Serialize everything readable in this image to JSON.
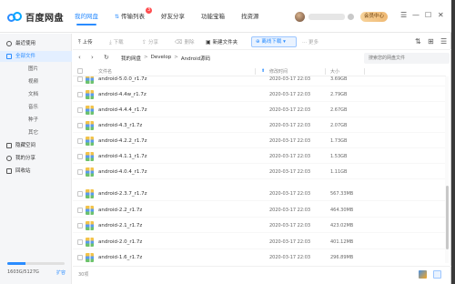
{
  "app": {
    "name": "百度网盘",
    "nav": [
      {
        "label": "我的网盘",
        "active": true
      },
      {
        "label": "传输列表",
        "badge": "3"
      },
      {
        "label": "好友分享"
      },
      {
        "label": "功能宝箱"
      },
      {
        "label": "找资源"
      }
    ],
    "vip_label": "会员中心",
    "window_controls": [
      "☰",
      "—",
      "☐",
      "✕"
    ]
  },
  "sidebar": {
    "items": [
      {
        "label": "最近使用",
        "icon": "clock-icon"
      },
      {
        "label": "全部文件",
        "icon": "folder-icon",
        "active": true
      },
      {
        "label": "图片",
        "sub": true
      },
      {
        "label": "视频",
        "sub": true
      },
      {
        "label": "文档",
        "sub": true
      },
      {
        "label": "音乐",
        "sub": true
      },
      {
        "label": "种子",
        "sub": true
      },
      {
        "label": "其它",
        "sub": true
      },
      {
        "label": "隐藏空间",
        "icon": "lock-icon"
      },
      {
        "label": "我的分享",
        "icon": "share-icon"
      },
      {
        "label": "回收站",
        "icon": "trash-icon"
      }
    ],
    "quota": {
      "text": "1603G/5127G",
      "used_fraction": 0.313,
      "link": "扩容"
    }
  },
  "toolbar": {
    "upload": "上传",
    "download": "下载",
    "share": "分享",
    "delete": "删除",
    "new_folder": "新建文件夹",
    "offline": "离线下载",
    "more": "更多"
  },
  "path": {
    "crumbs": [
      "我的网盘",
      "Develop",
      "Android源码"
    ],
    "search_placeholder": "搜索您的网盘文件"
  },
  "table": {
    "headers": {
      "name": "文件名",
      "date": "修改时间",
      "size": "大小"
    },
    "rows": [
      {
        "name": "android-5.0.0_r1.7z",
        "date": "2020-03-17 22:03",
        "size": "3.69GB"
      },
      {
        "name": "android-4.4w_r1.7z",
        "date": "2020-03-17 22:03",
        "size": "2.79GB"
      },
      {
        "name": "android-4.4.4_r1.7z",
        "date": "2020-03-17 22:03",
        "size": "2.67GB"
      },
      {
        "name": "android-4.3_r1.7z",
        "date": "2020-03-17 22:03",
        "size": "2.07GB"
      },
      {
        "name": "android-4.2.2_r1.7z",
        "date": "2020-03-17 22:03",
        "size": "1.73GB"
      },
      {
        "name": "android-4.1.1_r1.7z",
        "date": "2020-03-17 22:03",
        "size": "1.53GB"
      },
      {
        "name": "android-4.0.4_r1.7z",
        "date": "2020-03-17 22:03",
        "size": "1.11GB"
      },
      {
        "name": "android-2.3.7_r1.7z",
        "date": "2020-03-17 22:03",
        "size": "567.33MB"
      },
      {
        "name": "android-2.2_r1.7z",
        "date": "2020-03-17 22:03",
        "size": "464.30MB"
      },
      {
        "name": "android-2.1_r1.7z",
        "date": "2020-03-17 22:03",
        "size": "423.02MB"
      },
      {
        "name": "android-2.0_r1.7z",
        "date": "2020-03-17 22:03",
        "size": "401.12MB"
      },
      {
        "name": "android-1.6_r1.7z",
        "date": "2020-03-17 22:03",
        "size": "296.89MB"
      }
    ]
  },
  "footer": {
    "count": "30项"
  },
  "colors": {
    "accent": "#2a8cff",
    "vip": "#efb974",
    "active_bg": "#e3efff"
  }
}
